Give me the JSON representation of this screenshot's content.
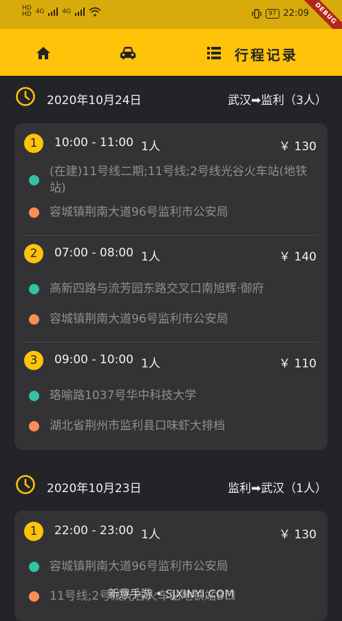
{
  "status_bar": {
    "left_label_top": "HD",
    "left_label_bottom": "HD",
    "signal_1": "4G",
    "signal_2": "4G",
    "battery": "97",
    "time": "22:09",
    "debug_banner": "DEBUG"
  },
  "nav": {
    "title": "行程记录",
    "home_icon": "home-icon",
    "car_icon": "car-icon",
    "list_icon": "list-icon"
  },
  "days": [
    {
      "date": "2020年10月24日",
      "route": "武汉➡监利（3人）",
      "trips": [
        {
          "index": "1",
          "time": "10:00 - 11:00",
          "people": "1人",
          "price": "￥ 130",
          "start": "(在建)11号线二期;11号线;2号线光谷火车站(地铁站)",
          "end": "容城镇荆南大道96号监利市公安局"
        },
        {
          "index": "2",
          "time": "07:00 - 08:00",
          "people": "1人",
          "price": "￥ 140",
          "start": "高新四路与流芳园东路交叉口南旭辉·御府",
          "end": "容城镇荆南大道96号监利市公安局"
        },
        {
          "index": "3",
          "time": "09:00 - 10:00",
          "people": "1人",
          "price": "￥ 110",
          "start": "珞喻路1037号华中科技大学",
          "end": "湖北省荆州市监利县口味虾大排档"
        }
      ]
    },
    {
      "date": "2020年10月23日",
      "route": "监利➡武汉（1人）",
      "trips": [
        {
          "index": "1",
          "time": "22:00 - 23:00",
          "people": "1人",
          "price": "￥ 130",
          "start": "容城镇荆南大道96号监利市公安局",
          "end": "11号线;2号线光谷火车站地铁站B口"
        }
      ]
    }
  ],
  "watermark": "新意手游 • SJXINYI.COM",
  "colors": {
    "accent": "#ffc309",
    "status_bar": "#d8ab0c",
    "background": "#232427",
    "card": "#333336",
    "start_dot": "#33c2a3",
    "end_dot": "#fb8e55"
  }
}
